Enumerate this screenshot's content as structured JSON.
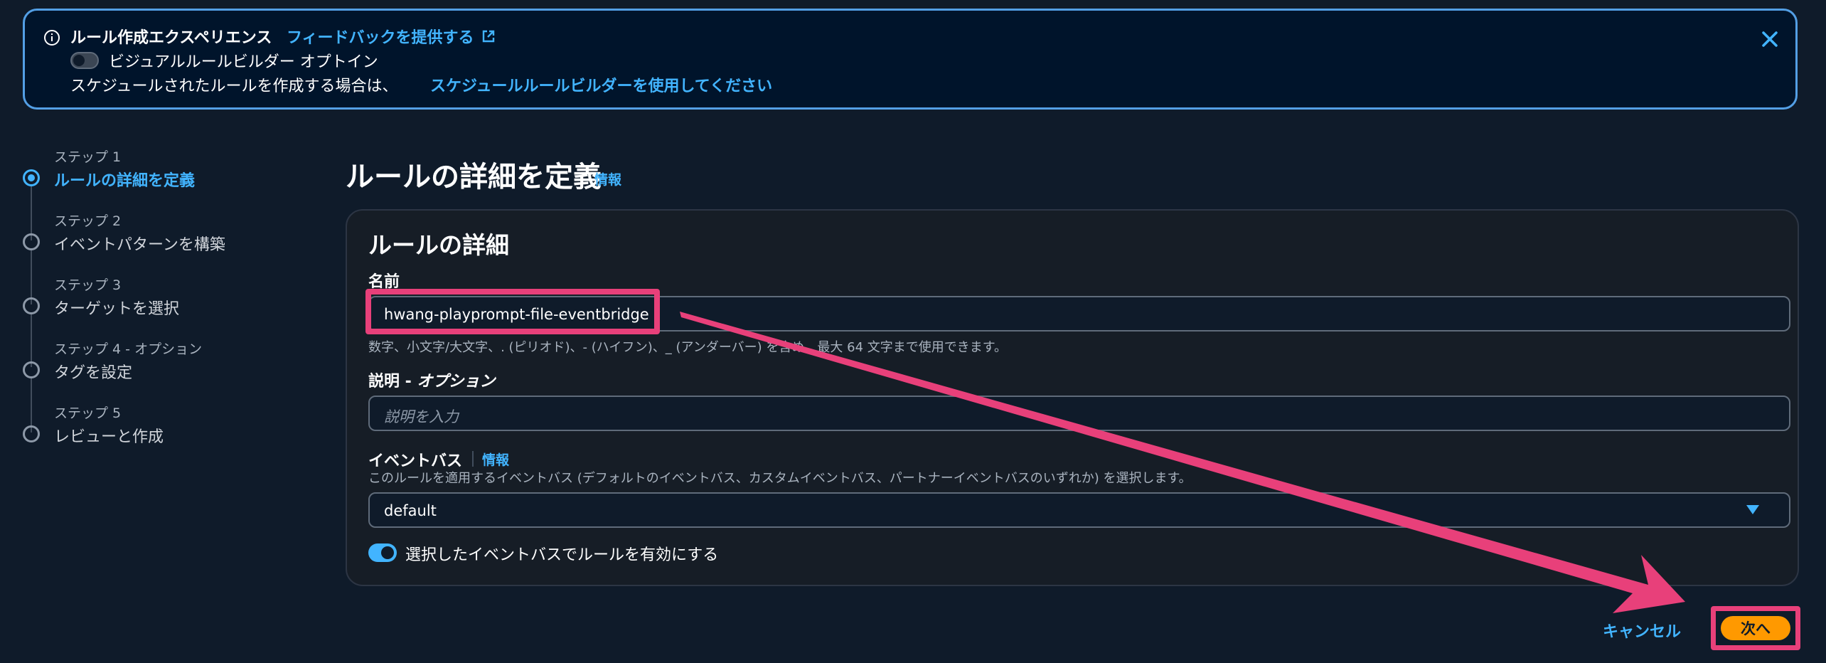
{
  "banner": {
    "title": "ルール作成エクスペリエンス",
    "feedback_link": "フィードバックを提供する",
    "toggle_label": "ビジュアルルールビルダー オプトイン",
    "schedule_text": "スケジュールされたルールを作成する場合は、",
    "schedule_link": "スケジュールルールビルダーを使用してください"
  },
  "steps": [
    {
      "label": "ステップ 1",
      "name": "ルールの詳細を定義"
    },
    {
      "label": "ステップ 2",
      "name": "イベントパターンを構築"
    },
    {
      "label": "ステップ 3",
      "name": "ターゲットを選択"
    },
    {
      "label": "ステップ 4 - オプション",
      "name": "タグを設定"
    },
    {
      "label": "ステップ 5",
      "name": "レビューと作成"
    }
  ],
  "main": {
    "title": "ルールの詳細を定義",
    "info": "情報"
  },
  "panel": {
    "title": "ルールの詳細",
    "name_label": "名前",
    "name_value": "hwang-playprompt-file-eventbridge",
    "name_hint": "数字、小文字/大文字、. (ピリオド)、- (ハイフン)、_ (アンダーバー) を含め、最大 64 文字まで使用できます。",
    "desc_label": "説明 - ",
    "desc_label_optional": "オプション",
    "desc_placeholder": "説明を入力",
    "bus_label": "イベントバス",
    "bus_info": "情報",
    "bus_hint": "このルールを適用するイベントバス (デフォルトのイベントバス、カスタムイベントバス、パートナーイベントバスのいずれか) を選択します。",
    "bus_value": "default",
    "enable_label": "選択したイベントバスでルールを有効にする"
  },
  "footer": {
    "cancel": "キャンセル",
    "next": "次へ"
  },
  "colors": {
    "accent": "#42b4ff",
    "annotation": "#e8407a",
    "primary_button": "#ff9900"
  }
}
